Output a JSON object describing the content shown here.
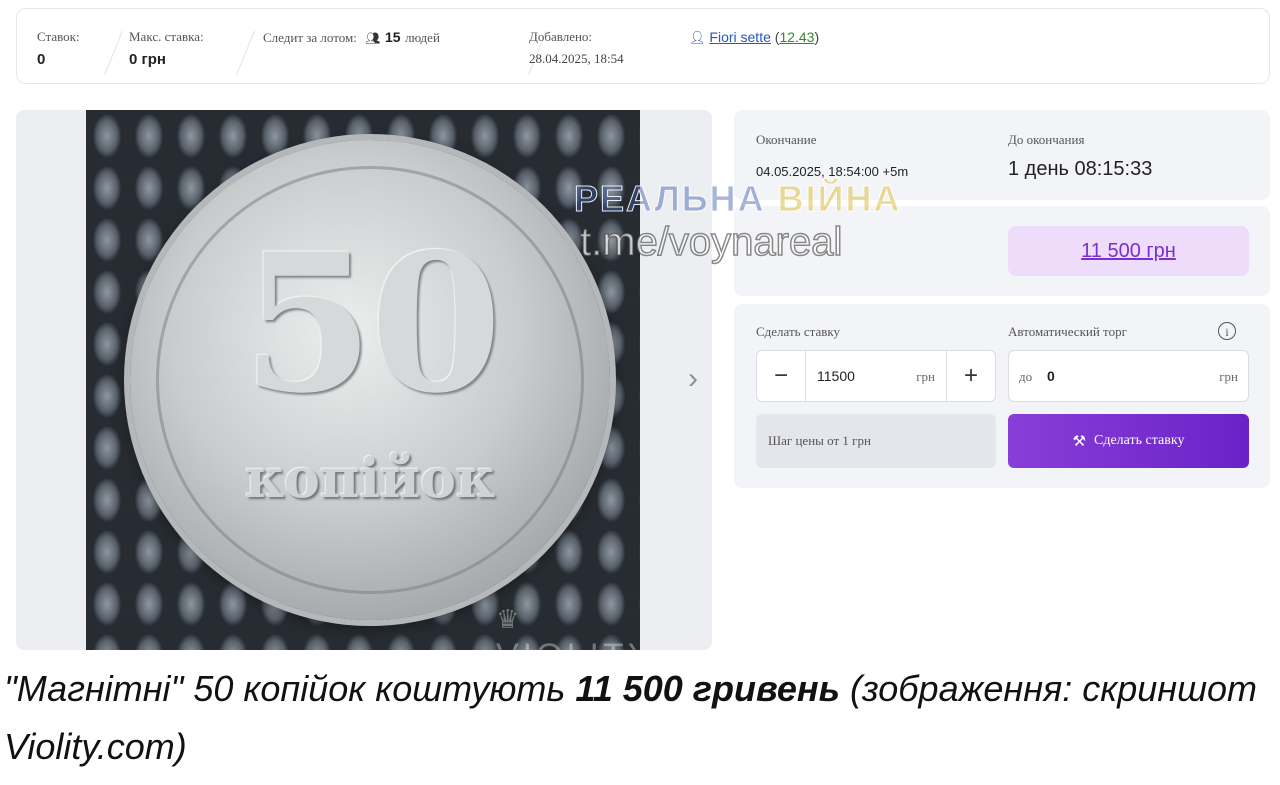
{
  "stats": {
    "bids_label": "Ставок:",
    "bids_value": "0",
    "max_bid_label": "Макс. ставка:",
    "max_bid_value": "0 грн",
    "watchers_label": "Следит за лотом:",
    "watchers_count": "15",
    "watchers_suffix": "людей",
    "added_label": "Добавлено:",
    "added_value": "28.04.2025, 18:54",
    "seller_name": "Fiori sette",
    "seller_rating": "12.43"
  },
  "photo": {
    "coin_number": "50",
    "coin_word": "копійок",
    "site_watermark": "VIOLITY"
  },
  "auction": {
    "end_label": "Окончание",
    "end_value": "04.05.2025, 18:54:00 +5m",
    "remaining_label": "До окончания",
    "remaining_value": "1 день 08:15:33",
    "current_price": "11 500 грн"
  },
  "bid": {
    "make_bid_label": "Сделать ставку",
    "bid_value": "11500",
    "bid_unit": "грн",
    "auto_label": "Автоматический торг",
    "auto_prefix": "до",
    "auto_value": "0",
    "auto_unit": "грн",
    "step_note": "Шаг цены от 1 грн",
    "submit_label": "Сделать ставку"
  },
  "overlay": {
    "channel_name_part1": "РЕАЛЬНА",
    "channel_name_part2": "ВІЙНА",
    "channel_link": "t.me/voynareal"
  },
  "caption": {
    "part1": "\"Магнітні\" 50 копійок коштують ",
    "bold": "11 500 гривень",
    "part2": " (зображення: скриншот Violity.com)"
  }
}
